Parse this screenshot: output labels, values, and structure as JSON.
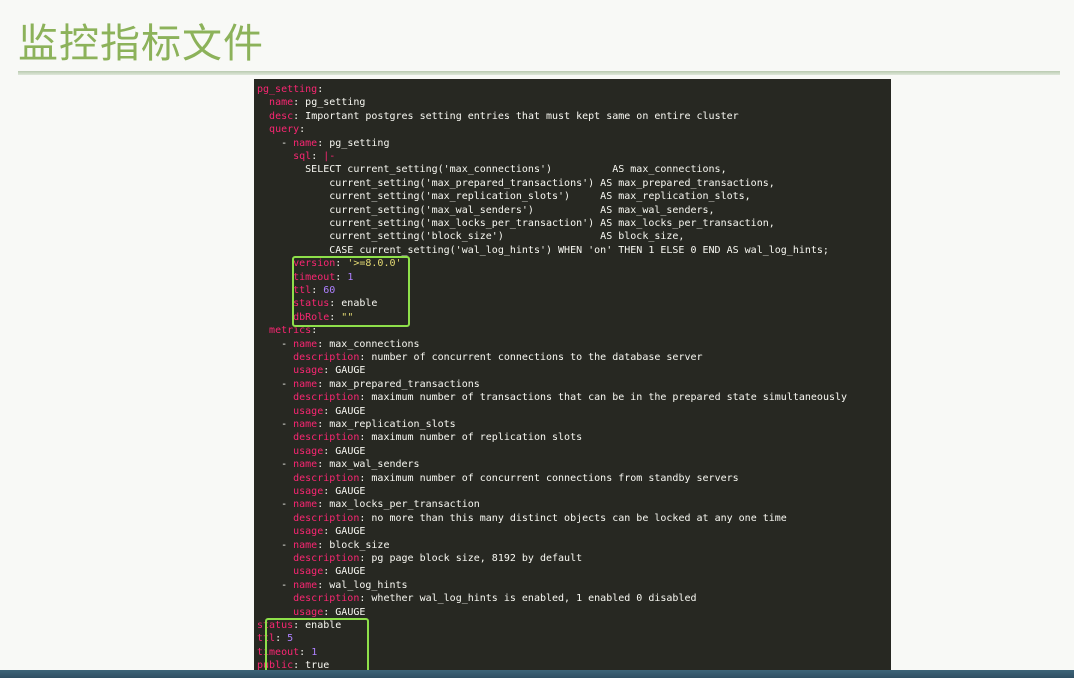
{
  "slide": {
    "title": "监控指标文件"
  },
  "code": {
    "lines": [
      {
        "segments": [
          {
            "t": "pg_setting",
            "c": "k"
          },
          {
            "t": ":",
            "c": ""
          }
        ]
      },
      {
        "segments": [
          {
            "t": "  ",
            "c": ""
          },
          {
            "t": "name",
            "c": "k"
          },
          {
            "t": ": pg_setting",
            "c": ""
          }
        ]
      },
      {
        "segments": [
          {
            "t": "  ",
            "c": ""
          },
          {
            "t": "desc",
            "c": "k"
          },
          {
            "t": ": Important postgres setting entries that must kept same on entire cluster",
            "c": ""
          }
        ]
      },
      {
        "segments": [
          {
            "t": "  ",
            "c": ""
          },
          {
            "t": "query",
            "c": "k"
          },
          {
            "t": ":",
            "c": ""
          }
        ]
      },
      {
        "segments": [
          {
            "t": "    - ",
            "c": ""
          },
          {
            "t": "name",
            "c": "k"
          },
          {
            "t": ": pg_setting",
            "c": ""
          }
        ]
      },
      {
        "segments": [
          {
            "t": "      ",
            "c": ""
          },
          {
            "t": "sql",
            "c": "k"
          },
          {
            "t": ": ",
            "c": ""
          },
          {
            "t": "|-",
            "c": "k"
          }
        ]
      },
      {
        "segments": [
          {
            "t": "        SELECT current_setting('max_connections')          AS max_connections,",
            "c": ""
          }
        ]
      },
      {
        "segments": [
          {
            "t": "            current_setting('max_prepared_transactions') AS max_prepared_transactions,",
            "c": ""
          }
        ]
      },
      {
        "segments": [
          {
            "t": "            current_setting('max_replication_slots')     AS max_replication_slots,",
            "c": ""
          }
        ]
      },
      {
        "segments": [
          {
            "t": "            current_setting('max_wal_senders')           AS max_wal_senders,",
            "c": ""
          }
        ]
      },
      {
        "segments": [
          {
            "t": "            current_setting('max_locks_per_transaction') AS max_locks_per_transaction,",
            "c": ""
          }
        ]
      },
      {
        "segments": [
          {
            "t": "            current_setting('block_size')                AS block_size,",
            "c": ""
          }
        ]
      },
      {
        "segments": [
          {
            "t": "            CASE current_setting('wal_log_hints') WHEN 'on' THEN 1 ELSE 0 END AS wal_log_hints;",
            "c": ""
          }
        ]
      },
      {
        "segments": [
          {
            "t": "      ",
            "c": ""
          },
          {
            "t": "version",
            "c": "k"
          },
          {
            "t": ": ",
            "c": ""
          },
          {
            "t": "'>=8.0.0'",
            "c": "s"
          }
        ]
      },
      {
        "segments": [
          {
            "t": "      ",
            "c": ""
          },
          {
            "t": "timeout",
            "c": "k"
          },
          {
            "t": ": ",
            "c": ""
          },
          {
            "t": "1",
            "c": "n"
          }
        ]
      },
      {
        "segments": [
          {
            "t": "      ",
            "c": ""
          },
          {
            "t": "ttl",
            "c": "k"
          },
          {
            "t": ": ",
            "c": ""
          },
          {
            "t": "60",
            "c": "n"
          }
        ]
      },
      {
        "segments": [
          {
            "t": "      ",
            "c": ""
          },
          {
            "t": "status",
            "c": "k"
          },
          {
            "t": ": enable",
            "c": ""
          }
        ]
      },
      {
        "segments": [
          {
            "t": "      ",
            "c": ""
          },
          {
            "t": "dbRole",
            "c": "k"
          },
          {
            "t": ": ",
            "c": ""
          },
          {
            "t": "\"\"",
            "c": "s"
          }
        ]
      },
      {
        "segments": [
          {
            "t": "  ",
            "c": ""
          },
          {
            "t": "metrics",
            "c": "k"
          },
          {
            "t": ":",
            "c": ""
          }
        ]
      },
      {
        "segments": [
          {
            "t": "    - ",
            "c": ""
          },
          {
            "t": "name",
            "c": "k"
          },
          {
            "t": ": max_connections",
            "c": ""
          }
        ]
      },
      {
        "segments": [
          {
            "t": "      ",
            "c": ""
          },
          {
            "t": "description",
            "c": "k"
          },
          {
            "t": ": number of concurrent connections to the database server",
            "c": ""
          }
        ]
      },
      {
        "segments": [
          {
            "t": "      ",
            "c": ""
          },
          {
            "t": "usage",
            "c": "k"
          },
          {
            "t": ": GAUGE",
            "c": ""
          }
        ]
      },
      {
        "segments": [
          {
            "t": "    - ",
            "c": ""
          },
          {
            "t": "name",
            "c": "k"
          },
          {
            "t": ": max_prepared_transactions",
            "c": ""
          }
        ]
      },
      {
        "segments": [
          {
            "t": "      ",
            "c": ""
          },
          {
            "t": "description",
            "c": "k"
          },
          {
            "t": ": maximum number of transactions that can be in the prepared state simultaneously",
            "c": ""
          }
        ]
      },
      {
        "segments": [
          {
            "t": "      ",
            "c": ""
          },
          {
            "t": "usage",
            "c": "k"
          },
          {
            "t": ": GAUGE",
            "c": ""
          }
        ]
      },
      {
        "segments": [
          {
            "t": "    - ",
            "c": ""
          },
          {
            "t": "name",
            "c": "k"
          },
          {
            "t": ": max_replication_slots",
            "c": ""
          }
        ]
      },
      {
        "segments": [
          {
            "t": "      ",
            "c": ""
          },
          {
            "t": "description",
            "c": "k"
          },
          {
            "t": ": maximum number of replication slots",
            "c": ""
          }
        ]
      },
      {
        "segments": [
          {
            "t": "      ",
            "c": ""
          },
          {
            "t": "usage",
            "c": "k"
          },
          {
            "t": ": GAUGE",
            "c": ""
          }
        ]
      },
      {
        "segments": [
          {
            "t": "    - ",
            "c": ""
          },
          {
            "t": "name",
            "c": "k"
          },
          {
            "t": ": max_wal_senders",
            "c": ""
          }
        ]
      },
      {
        "segments": [
          {
            "t": "      ",
            "c": ""
          },
          {
            "t": "description",
            "c": "k"
          },
          {
            "t": ": maximum number of concurrent connections from standby servers",
            "c": ""
          }
        ]
      },
      {
        "segments": [
          {
            "t": "      ",
            "c": ""
          },
          {
            "t": "usage",
            "c": "k"
          },
          {
            "t": ": GAUGE",
            "c": ""
          }
        ]
      },
      {
        "segments": [
          {
            "t": "    - ",
            "c": ""
          },
          {
            "t": "name",
            "c": "k"
          },
          {
            "t": ": max_locks_per_transaction",
            "c": ""
          }
        ]
      },
      {
        "segments": [
          {
            "t": "      ",
            "c": ""
          },
          {
            "t": "description",
            "c": "k"
          },
          {
            "t": ": no more than this many distinct objects can be locked at any one time",
            "c": ""
          }
        ]
      },
      {
        "segments": [
          {
            "t": "      ",
            "c": ""
          },
          {
            "t": "usage",
            "c": "k"
          },
          {
            "t": ": GAUGE",
            "c": ""
          }
        ]
      },
      {
        "segments": [
          {
            "t": "    - ",
            "c": ""
          },
          {
            "t": "name",
            "c": "k"
          },
          {
            "t": ": block_size",
            "c": ""
          }
        ]
      },
      {
        "segments": [
          {
            "t": "      ",
            "c": ""
          },
          {
            "t": "description",
            "c": "k"
          },
          {
            "t": ": pg page block size, 8192 by default",
            "c": ""
          }
        ]
      },
      {
        "segments": [
          {
            "t": "      ",
            "c": ""
          },
          {
            "t": "usage",
            "c": "k"
          },
          {
            "t": ": GAUGE",
            "c": ""
          }
        ]
      },
      {
        "segments": [
          {
            "t": "    - ",
            "c": ""
          },
          {
            "t": "name",
            "c": "k"
          },
          {
            "t": ": wal_log_hints",
            "c": ""
          }
        ]
      },
      {
        "segments": [
          {
            "t": "      ",
            "c": ""
          },
          {
            "t": "description",
            "c": "k"
          },
          {
            "t": ": whether wal_log_hints is enabled, 1 enabled 0 disabled",
            "c": ""
          }
        ]
      },
      {
        "segments": [
          {
            "t": "      ",
            "c": ""
          },
          {
            "t": "usage",
            "c": "k"
          },
          {
            "t": ": GAUGE",
            "c": ""
          }
        ]
      },
      {
        "segments": [
          {
            "t": "status",
            "c": "k"
          },
          {
            "t": ": enable",
            "c": ""
          }
        ]
      },
      {
        "segments": [
          {
            "t": "ttl",
            "c": "k"
          },
          {
            "t": ": ",
            "c": ""
          },
          {
            "t": "5",
            "c": "n"
          }
        ]
      },
      {
        "segments": [
          {
            "t": "timeout",
            "c": "k"
          },
          {
            "t": ": ",
            "c": ""
          },
          {
            "t": "1",
            "c": "n"
          }
        ]
      },
      {
        "segments": [
          {
            "t": "public",
            "c": "k"
          },
          {
            "t": ": true",
            "c": ""
          }
        ]
      }
    ]
  }
}
